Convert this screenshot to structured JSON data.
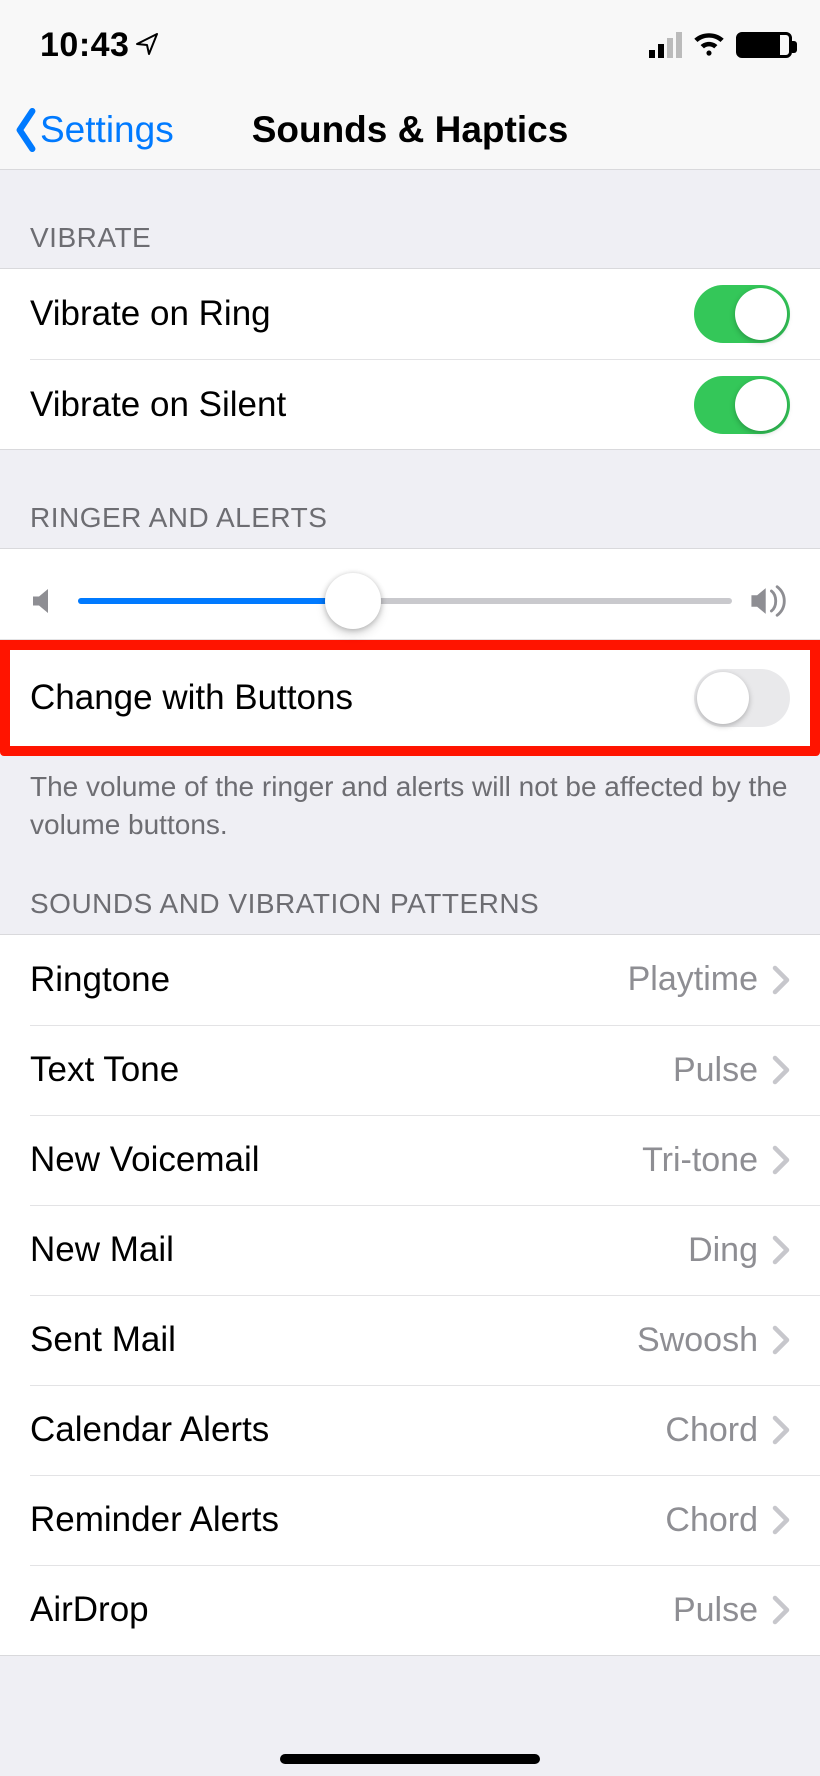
{
  "status": {
    "time": "10:43"
  },
  "nav": {
    "back_label": "Settings",
    "title": "Sounds & Haptics"
  },
  "vibrate": {
    "header": "Vibrate",
    "rows": [
      {
        "label": "Vibrate on Ring",
        "on": true
      },
      {
        "label": "Vibrate on Silent",
        "on": true
      }
    ]
  },
  "ringer": {
    "header": "Ringer and Alerts",
    "slider_percent": 42,
    "change_with_buttons": {
      "label": "Change with Buttons",
      "on": false
    },
    "footer": "The volume of the ringer and alerts will not be affected by the volume buttons."
  },
  "patterns": {
    "header": "Sounds and Vibration Patterns",
    "rows": [
      {
        "label": "Ringtone",
        "value": "Playtime"
      },
      {
        "label": "Text Tone",
        "value": "Pulse"
      },
      {
        "label": "New Voicemail",
        "value": "Tri-tone"
      },
      {
        "label": "New Mail",
        "value": "Ding"
      },
      {
        "label": "Sent Mail",
        "value": "Swoosh"
      },
      {
        "label": "Calendar Alerts",
        "value": "Chord"
      },
      {
        "label": "Reminder Alerts",
        "value": "Chord"
      },
      {
        "label": "AirDrop",
        "value": "Pulse"
      }
    ]
  }
}
